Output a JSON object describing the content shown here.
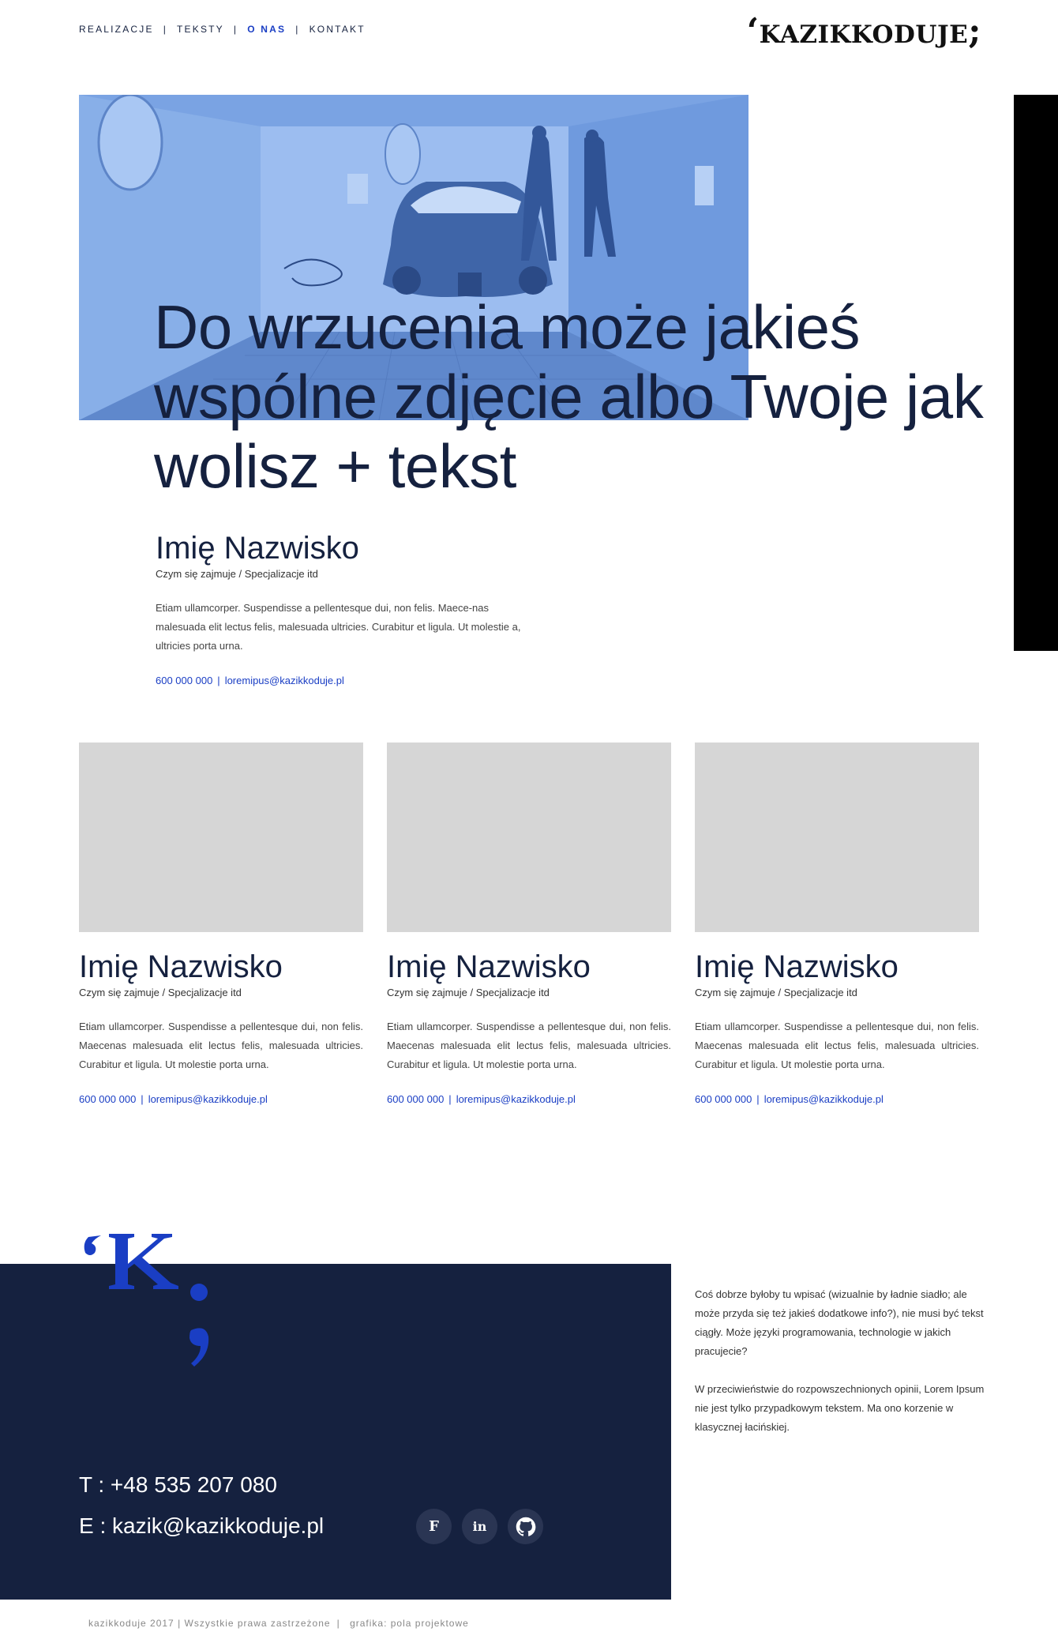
{
  "nav": {
    "items": [
      {
        "label": "REALIZACJE",
        "active": false
      },
      {
        "label": "TEKSTY",
        "active": false
      },
      {
        "label": "O NAS",
        "active": true
      },
      {
        "label": "KONTAKT",
        "active": false
      }
    ],
    "separator": "|"
  },
  "logo": "‘kazikkoduje;",
  "hero": {
    "title": "Do wrzucenia może jakieś wspólne zdjęcie albo Twoje jak wolisz + tekst",
    "image_tint": "#7aa3e3"
  },
  "main_person": {
    "name": "Imię Nazwisko",
    "role": "Czym się zajmuje / Specjalizacje itd",
    "description": "Etiam ullamcorper. Suspendisse a pellentesque dui, non felis. Maece-nas malesuada elit lectus felis, malesuada ultricies. Curabitur et ligula. Ut molestie a, ultricies porta urna.",
    "phone": "600 000 000",
    "email": "loremipus@kazikkoduje.pl"
  },
  "team": [
    {
      "name": "Imię Nazwisko",
      "role": "Czym się zajmuje / Specjalizacje itd",
      "description": "Etiam ullamcorper. Suspendisse a pellentesque dui, non felis. Maecenas malesuada elit lectus felis, malesuada ultricies. Curabitur et ligula. Ut molestie porta urna.",
      "phone": "600 000 000",
      "email": "loremipus@kazikkoduje.pl"
    },
    {
      "name": "Imię Nazwisko",
      "role": "Czym się zajmuje / Specjalizacje itd",
      "description": "Etiam ullamcorper. Suspendisse a pellentesque dui, non felis. Maecenas malesuada elit lectus felis, malesuada ultricies. Curabitur et ligula. Ut molestie porta urna.",
      "phone": "600 000 000",
      "email": "loremipus@kazikkoduje.pl"
    },
    {
      "name": "Imię Nazwisko",
      "role": "Czym się zajmuje / Specjalizacje itd",
      "description": "Etiam ullamcorper. Suspendisse a pellentesque dui, non felis. Maecenas malesuada elit lectus felis, malesuada ultricies. Curabitur et ligula. Ut molestie porta urna.",
      "phone": "600 000 000",
      "email": "loremipus@kazikkoduje.pl"
    }
  ],
  "footer": {
    "phone": "T : +48 535 207 080",
    "email": "E : kazik@kazikkoduje.pl",
    "socials": [
      {
        "label": "F",
        "icon": "facebook-icon"
      },
      {
        "label": "in",
        "icon": "linkedin-icon"
      },
      {
        "label": "",
        "icon": "github-icon"
      }
    ],
    "text_1": "Coś dobrze byłoby tu wpisać (wizualnie by ładnie siadło; ale może przyda się też jakieś dodatkowe info?), nie musi być tekst ciągły. Może języki programowania, technologie w jakich pracujecie?",
    "text_2": "W przeciwieństwie do rozpowszechnionych opinii, Lorem Ipsum nie jest tylko przypadkowym tekstem. Ma ono korzenie w klasycznej łacińskiej.",
    "copyright": "kazikkoduje 2017 |",
    "rights": "Wszystkie prawa zastrzeżone",
    "credits": "grafika: pola projektowe",
    "colors": {
      "navy": "#15213f",
      "accent": "#1a3ec4"
    }
  }
}
